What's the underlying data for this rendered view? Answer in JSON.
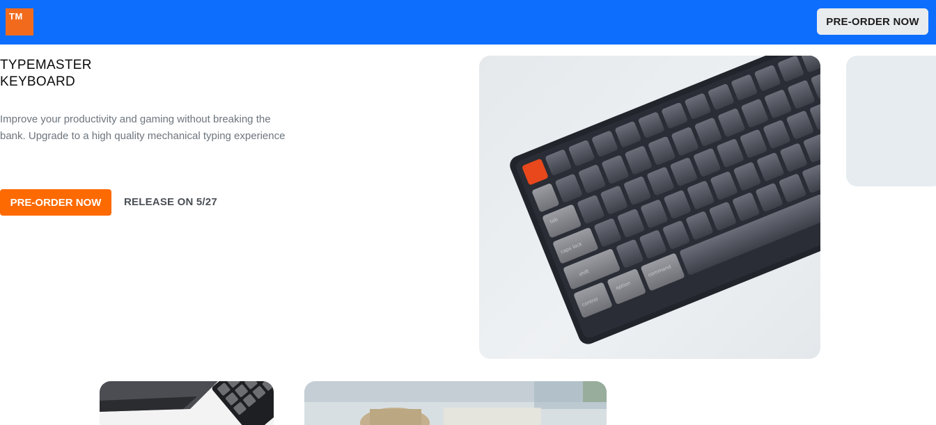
{
  "header": {
    "logo_text": "TM",
    "cta_label": "PRE-ORDER NOW",
    "brand_color": "#0d6efd"
  },
  "hero": {
    "title_line1": "TYPEMASTER",
    "title_line2": "KEYBOARD",
    "description": "Improve your productivity and gaming without breaking the bank. Upgrade to a high quality mechanical typing experience",
    "primary_cta": "PRE-ORDER NOW",
    "release_text": "RELEASE ON 5/27",
    "accent_color": "#fd6a02"
  },
  "images": {
    "hero": "mechanical-keyboard-photo",
    "side_card": "blank-card",
    "thumb1": "keyboard-closeup-photo",
    "thumb2": "desk-blurred-photo"
  }
}
